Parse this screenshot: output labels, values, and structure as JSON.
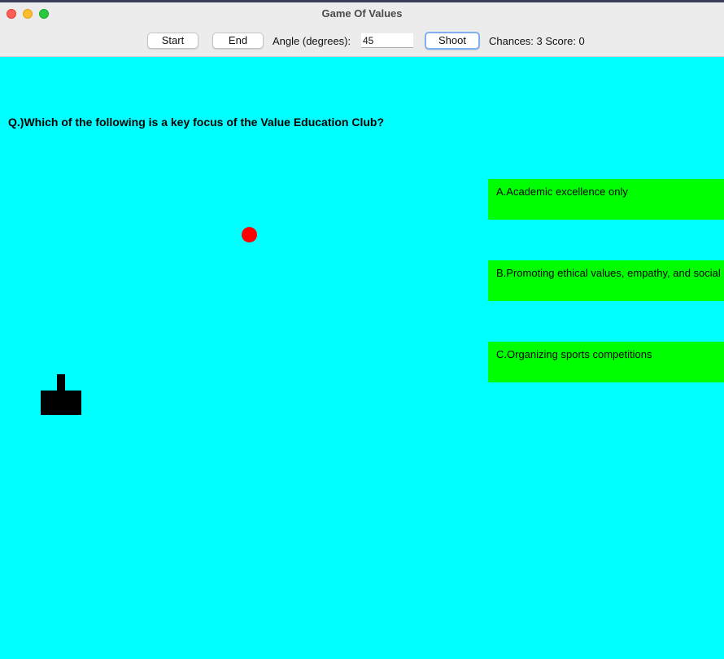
{
  "window": {
    "title": "Game Of Values"
  },
  "toolbar": {
    "start_label": "Start",
    "end_label": "End",
    "angle_label": "Angle (degrees):",
    "angle_value": "45",
    "shoot_label": "Shoot",
    "status_text": "Chances: 3 Score: 0"
  },
  "game": {
    "question": "Q.)Which of the following is a key focus of the Value Education Club?",
    "answers": [
      {
        "label": "A.Academic excellence only"
      },
      {
        "label": "B.Promoting ethical values, empathy, and social responsibility"
      },
      {
        "label": "C.Organizing sports competitions"
      }
    ]
  },
  "colors": {
    "background": "#00ffff",
    "answer_box": "#00ff00",
    "target": "#ff0000",
    "cannon": "#000000"
  }
}
